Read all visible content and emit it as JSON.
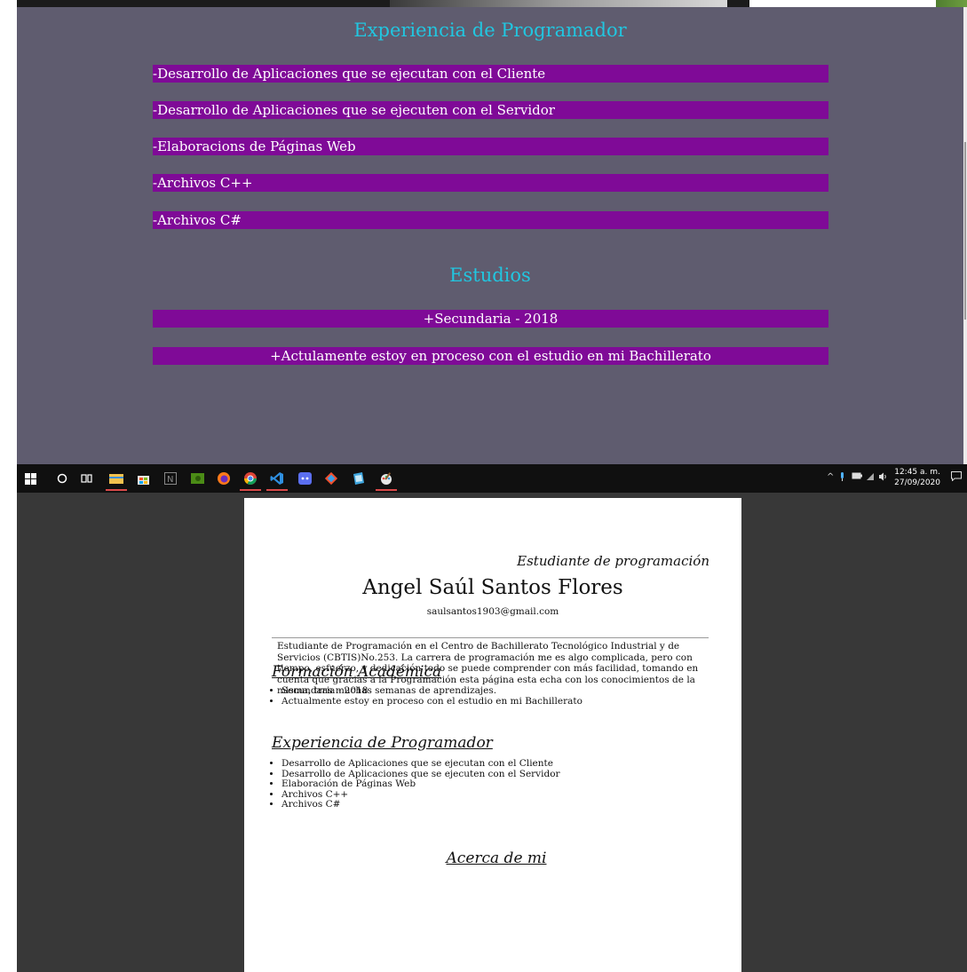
{
  "site": {
    "experience_title": "Experiencia de Programador",
    "experience_items": [
      "-Desarrollo de Aplicaciones que se ejecutan con el Cliente",
      "-Desarrollo de Aplicaciones que se ejecuten con el Servidor",
      "-Elaboracions de Páginas Web",
      "-Archivos C++",
      "-Archivos C#"
    ],
    "studies_title": "Estudios",
    "studies_items": [
      "+Secundaria - 2018",
      "+Actulamente estoy en proceso con el estudio en mi Bachillerato"
    ],
    "colors": {
      "background": "#5f5c6f",
      "title": "#21c6e0",
      "bar": "#7f0a97"
    }
  },
  "taskbar": {
    "icons": [
      "windows-start-icon",
      "search-circle-icon",
      "task-view-icon",
      "file-explorer-icon",
      "store-icon",
      "notion-icon",
      "nvidia-icon",
      "firefox-icon",
      "chrome-icon",
      "vscode-icon",
      "discord-icon",
      "git-icon",
      "app-icon",
      "paint-icon"
    ],
    "time": "12:45 a. m.",
    "date": "27/09/2020"
  },
  "document": {
    "subtitle": "Estudiante de programación",
    "name": "Angel Saúl Santos Flores",
    "email": "saulsantos1903@gmail.com",
    "education_heading": "Formación Académica",
    "education_items": [
      "Secundaria - 2018",
      "Actualmente estoy en proceso con el estudio en mi Bachillerato"
    ],
    "experience_heading": "Experiencia de Programador",
    "experience_items": [
      "Desarrollo de Aplicaciones que se ejecutan con el Cliente",
      "Desarrollo de Aplicaciones que se ejecuten con el Servidor",
      "Elaboración de Páginas Web",
      "Archivos C++",
      "Archivos C#"
    ],
    "about_heading": "Acerca de mi",
    "about_text": "Estudiante de Programación en el Centro de Bachillerato Tecnológico Industrial y de Servicios (CBTIS)No.253. La carrera de programación me es algo complicada, pero con tiempo, esfuerzo, y dedicación todo se puede comprender con más facilidad, tomando en cuenta que gracias a la Programación esta página esta echa con los conocimientos de la misma, tras muchas semanas de aprendizajes."
  }
}
